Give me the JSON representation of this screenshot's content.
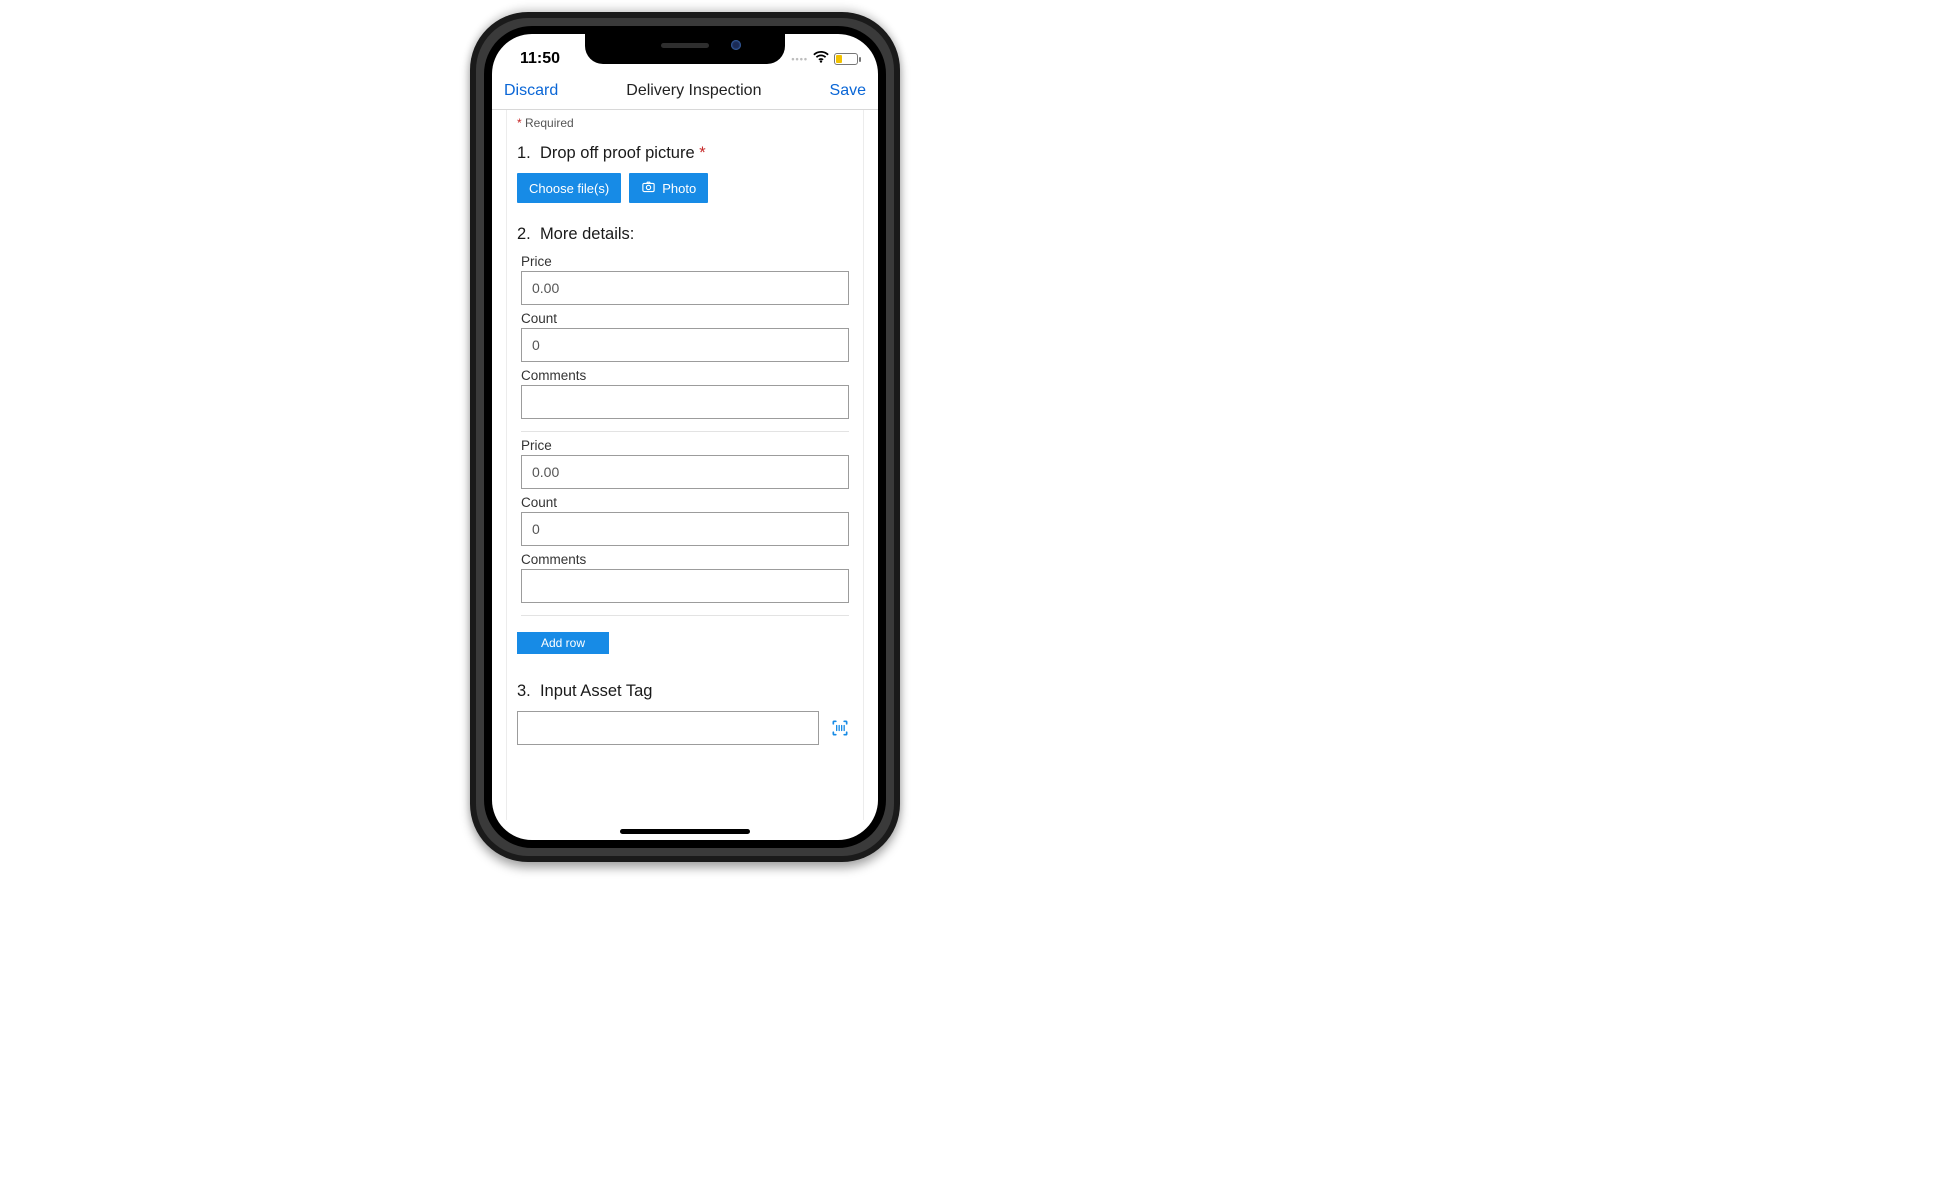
{
  "status": {
    "time": "11:50"
  },
  "nav": {
    "discard": "Discard",
    "title": "Delivery Inspection",
    "save": "Save"
  },
  "required_note": "Required",
  "questions": {
    "q1": {
      "number": "1.",
      "title": "Drop off proof picture",
      "required_mark": "*",
      "choose_files": "Choose file(s)",
      "photo": "Photo"
    },
    "q2": {
      "number": "2.",
      "title": "More details:",
      "labels": {
        "price": "Price",
        "count": "Count",
        "comments": "Comments"
      },
      "rows": [
        {
          "price": "0.00",
          "count": "0",
          "comments": ""
        },
        {
          "price": "0.00",
          "count": "0",
          "comments": ""
        }
      ],
      "add_row": "Add row"
    },
    "q3": {
      "number": "3.",
      "title": "Input Asset Tag",
      "value": ""
    }
  }
}
